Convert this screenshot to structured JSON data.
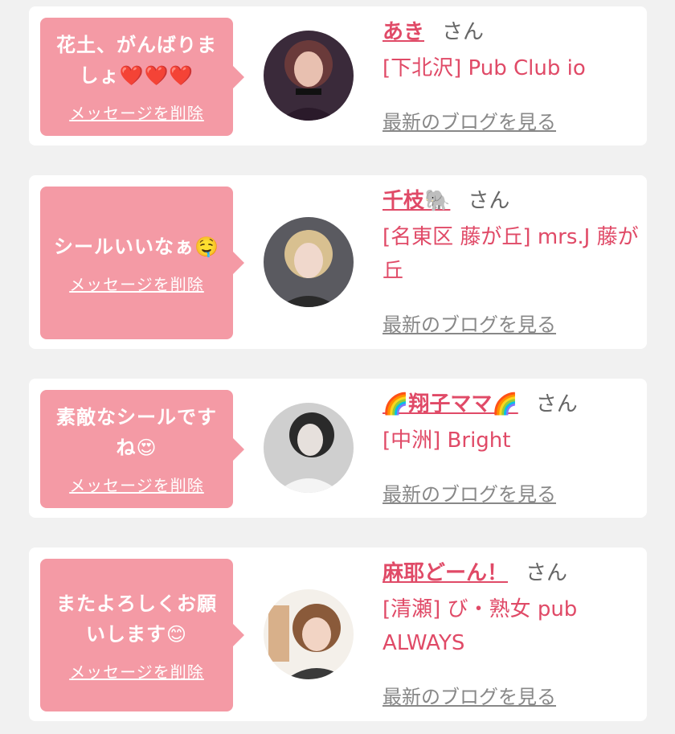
{
  "messages": [
    {
      "text": "花土、がんばりましょ❤️❤️❤️",
      "delete_label": "メッセージを削除",
      "name": "あき",
      "honorific": "さん",
      "shop": "[下北沢] Pub Club io",
      "blog_link": "最新のブログを見る"
    },
    {
      "text": "シールいいなぁ🤤",
      "delete_label": "メッセージを削除",
      "name": "千枝🐘",
      "honorific": "さん",
      "shop": "[名東区 藤が丘] mrs.J 藤が丘",
      "blog_link": "最新のブログを見る"
    },
    {
      "text": "素敵なシールですね😍",
      "delete_label": "メッセージを削除",
      "name": "🌈翔子ママ🌈",
      "honorific": "さん",
      "shop": "[中洲] Bright",
      "blog_link": "最新のブログを見る"
    },
    {
      "text": "またよろしくお願いします😊",
      "delete_label": "メッセージを削除",
      "name": "麻耶どーん！",
      "honorific": "さん",
      "shop": "[清瀬] び・熟女 pub ALWAYS",
      "blog_link": "最新のブログを見る"
    }
  ],
  "colors": {
    "bubble": "#f49aa5",
    "accent": "#e04a67",
    "background": "#f1f1f1"
  }
}
